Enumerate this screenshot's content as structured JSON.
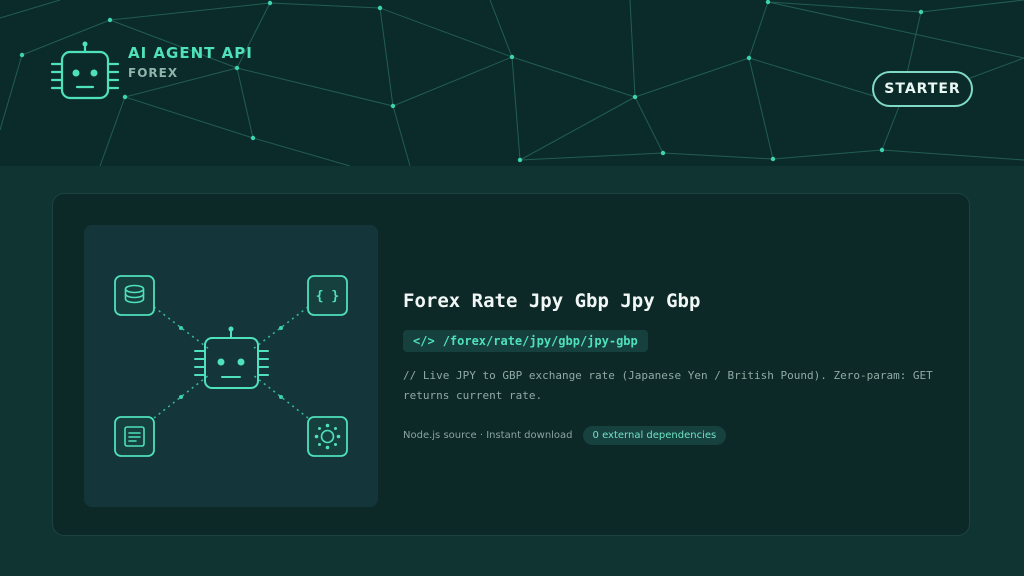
{
  "header": {
    "brand_title": "AI AGENT API",
    "brand_subtitle": "FOREX",
    "logo_icon": "robot-icon",
    "starter_label": "STARTER"
  },
  "card": {
    "title": "Forex Rate Jpy Gbp Jpy Gbp",
    "endpoint_icon": "</>",
    "endpoint_path": "/forex/rate/jpy/gbp/jpy-gbp",
    "description": "// Live JPY to GBP exchange rate (Japanese Yen / British Pound). Zero-param: GET returns current rate.",
    "source_text": "Node.js source · Instant download",
    "deps_badge": "0 external dependencies",
    "illustration": {
      "center_icon": "robot-icon",
      "nodes": [
        "database-icon",
        "code-braces-icon",
        "document-icon",
        "network-hub-icon"
      ],
      "code_node_text": "{ }"
    }
  },
  "colors": {
    "accent": "#4fe0bc",
    "header_bg": "#0b2b2a",
    "page_bg": "#0f3431",
    "card_bg": "#0c2827"
  }
}
